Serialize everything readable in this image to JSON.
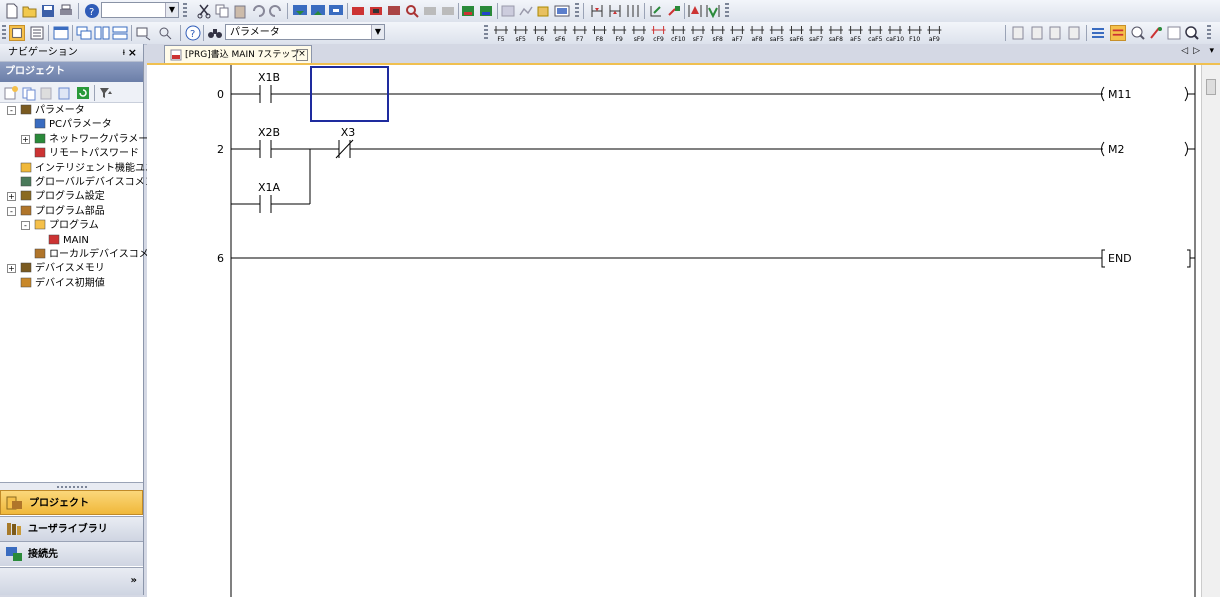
{
  "toolbar": {
    "combo1_value": "",
    "combo2_value": "パラメータ",
    "key_labels": [
      "F5",
      "sF5",
      "F6",
      "sF6",
      "F7",
      "F8",
      "F9",
      "sF9",
      "cF9",
      "cF10",
      "sF7",
      "sF8",
      "aF7",
      "aF8",
      "saF5",
      "saF6",
      "saF7",
      "saF8",
      "aF5",
      "caF5",
      "caF10",
      "F10",
      "aF9"
    ]
  },
  "nav": {
    "header": "ナビゲーション",
    "pin": "ᵼ",
    "close": "×",
    "project_header": "プロジェクト",
    "tree": [
      {
        "label": "パラメータ",
        "level": 0,
        "expander": "-"
      },
      {
        "label": "PCパラメータ",
        "level": 1,
        "expander": ""
      },
      {
        "label": "ネットワークパラメータ",
        "level": 1,
        "expander": "+"
      },
      {
        "label": "リモートパスワード",
        "level": 1,
        "expander": ""
      },
      {
        "label": "インテリジェント機能ユニット",
        "level": 0,
        "expander": ""
      },
      {
        "label": "グローバルデバイスコメント",
        "level": 0,
        "expander": ""
      },
      {
        "label": "プログラム設定",
        "level": 0,
        "expander": "+"
      },
      {
        "label": "プログラム部品",
        "level": 0,
        "expander": "-"
      },
      {
        "label": "プログラム",
        "level": 1,
        "expander": "-"
      },
      {
        "label": "MAIN",
        "level": 2,
        "expander": ""
      },
      {
        "label": "ローカルデバイスコメント",
        "level": 1,
        "expander": ""
      },
      {
        "label": "デバイスメモリ",
        "level": 0,
        "expander": "+"
      },
      {
        "label": "デバイス初期値",
        "level": 0,
        "expander": ""
      }
    ],
    "bottom_buttons": [
      "プロジェクト",
      "ユーザライブラリ",
      "接続先"
    ],
    "more": "»"
  },
  "editor": {
    "tab_label": "[PRG]書込 MAIN 7ステップ",
    "tab_close": "×",
    "tab_nav": [
      "◁",
      "▷",
      "▾"
    ],
    "rungs": [
      {
        "step": "0",
        "contacts": [
          {
            "name": "X1B",
            "type": "NO"
          }
        ],
        "coil": "M11"
      },
      {
        "step": "2",
        "contacts": [
          {
            "name": "X2B",
            "type": "NO"
          },
          {
            "name": "X3",
            "type": "NC"
          }
        ],
        "branch": {
          "name": "X1A",
          "type": "NO"
        },
        "coil": "M2"
      },
      {
        "step": "6",
        "instruction": "END"
      }
    ]
  },
  "colors": {
    "selection_box": "#1e2b9e",
    "active_bottom_button": "#f5c04a",
    "tab_accent": "#f0c050"
  }
}
